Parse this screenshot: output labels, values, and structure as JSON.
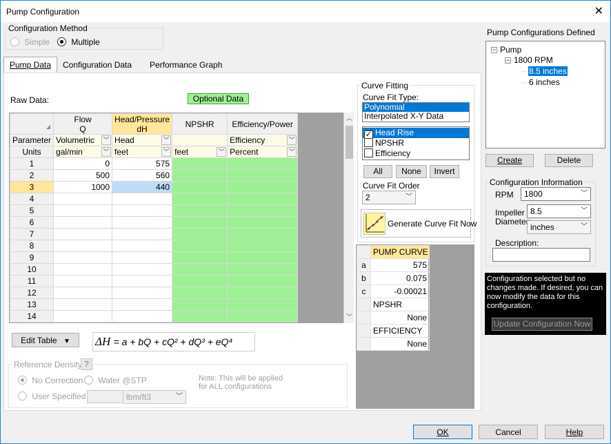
{
  "window": {
    "title": "Pump Configuration",
    "close_label": "✕"
  },
  "config_method": {
    "label": "Configuration Method",
    "simple": "Simple",
    "multiple": "Multiple",
    "selected": "Multiple"
  },
  "tabs": [
    "Pump Data",
    "Configuration Data",
    "Performance Graph"
  ],
  "raw_data": {
    "label": "Raw Data:",
    "optional_button": "Optional Data",
    "columns": [
      {
        "line1": "Flow",
        "line2": "Q"
      },
      {
        "line1": "Head/Pressure",
        "line2": "dH"
      },
      {
        "line1": "NPSHR",
        "line2": ""
      },
      {
        "line1": "Efficiency/Power",
        "line2": ""
      }
    ],
    "parameter_label": "Parameter",
    "units_label": "Units",
    "parameters": [
      "Volumetric",
      "Head",
      "",
      "Efficiency"
    ],
    "units": [
      "gal/min",
      "feet",
      "feet",
      "Percent"
    ],
    "rows": [
      {
        "n": "1",
        "flow": "0",
        "head": "575"
      },
      {
        "n": "2",
        "flow": "500",
        "head": "560"
      },
      {
        "n": "3",
        "flow": "1000",
        "head": "440"
      },
      {
        "n": "4",
        "flow": "",
        "head": ""
      },
      {
        "n": "5",
        "flow": "",
        "head": ""
      },
      {
        "n": "6",
        "flow": "",
        "head": ""
      },
      {
        "n": "7",
        "flow": "",
        "head": ""
      },
      {
        "n": "8",
        "flow": "",
        "head": ""
      },
      {
        "n": "9",
        "flow": "",
        "head": ""
      },
      {
        "n": "10",
        "flow": "",
        "head": ""
      },
      {
        "n": "11",
        "flow": "",
        "head": ""
      },
      {
        "n": "12",
        "flow": "",
        "head": ""
      },
      {
        "n": "13",
        "flow": "",
        "head": ""
      },
      {
        "n": "14",
        "flow": "",
        "head": ""
      }
    ],
    "selected_row": "3"
  },
  "edit_table": "Edit Table",
  "equation": {
    "lhs": "ΔH",
    "rhs": "= a + bQ + cQ² + dQ³ + eQ⁴"
  },
  "reference_density": {
    "label": "Reference Density",
    "help": "?",
    "no_correction": "No Correction",
    "water_stp": "Water @STP",
    "user_specified": "User Specified",
    "unit": "lbm/ft3",
    "note_line1": "Note: This will be applied",
    "note_line2": "for ALL configurations"
  },
  "curve_fitting": {
    "label": "Curve Fitting",
    "type_label": "Curve Fit Type:",
    "types": [
      "Polynomial",
      "Interpolated X-Y Data"
    ],
    "selected_type": "Polynomial",
    "checks": [
      {
        "label": "Head Rise",
        "checked": true
      },
      {
        "label": "NPSHR",
        "checked": false
      },
      {
        "label": "Efficiency",
        "checked": false
      }
    ],
    "all": "All",
    "none": "None",
    "invert": "Invert",
    "order_label": "Curve Fit Order",
    "order": "2",
    "generate": "Generate Curve Fit Now"
  },
  "results": {
    "pump_curve": "PUMP CURVE",
    "coeffs": [
      {
        "k": "a",
        "v": "575"
      },
      {
        "k": "b",
        "v": "0.075"
      },
      {
        "k": "c",
        "v": "-0.00021"
      }
    ],
    "npshr": "NPSHR",
    "npshr_value": "None",
    "efficiency": "EFFICIENCY",
    "efficiency_value": "None"
  },
  "configs": {
    "label": "Pump Configurations Defined",
    "root": "Pump",
    "child": "1800 RPM",
    "leaves": [
      "8.5 inches",
      "6 inches"
    ],
    "selected": "8.5 inches",
    "create": "Create",
    "delete": "Delete"
  },
  "config_info": {
    "label": "Configuration Information",
    "rpm_label": "RPM",
    "rpm": "1800",
    "impeller_label1": "Impeller",
    "impeller_label2": "Diameter:",
    "impeller": "8.5",
    "impeller_unit": "inches",
    "description_label": "Description:",
    "description": ""
  },
  "status_message": "Configuration selected but no changes made. If desired, you can now modify the data for this configuration.",
  "update_button": "Update Configuration Now",
  "footer": {
    "ok": "OK",
    "cancel": "Cancel",
    "help": "Help"
  },
  "colors": {
    "accent": "#0078d7",
    "optional_green": "#9ef094",
    "selection_yellow": "#ffe69b"
  }
}
